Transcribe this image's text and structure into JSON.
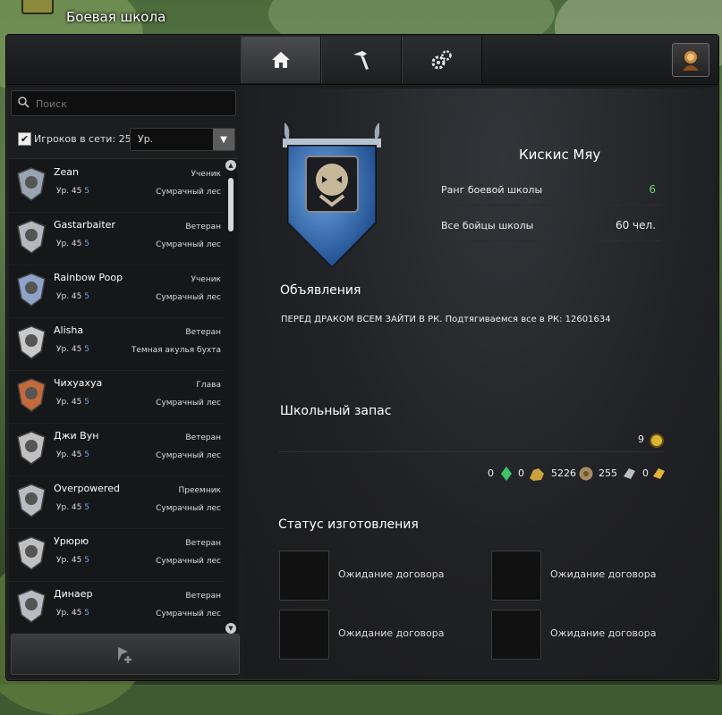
{
  "window": {
    "title": "Боевая школа"
  },
  "tabs": [
    {
      "icon": "home-icon",
      "active": true
    },
    {
      "icon": "hammer-icon",
      "active": false
    },
    {
      "icon": "gears-icon",
      "active": false
    }
  ],
  "left": {
    "search_placeholder": "Поиск",
    "online_label": "Игроков в сети: 25",
    "online_checked": true,
    "sort_value": "Ур."
  },
  "members": [
    {
      "name": "Zean",
      "rank": "Ученик",
      "level_prefix": "Ур. 45",
      "level_sub": "5",
      "location": "Сумрачный лес"
    },
    {
      "name": "Gastarbaiter",
      "rank": "Ветеран",
      "level_prefix": "Ур. 45",
      "level_sub": "5",
      "location": "Сумрачный лес"
    },
    {
      "name": "Rainbow Poop",
      "rank": "Ученик",
      "level_prefix": "Ур. 45",
      "level_sub": "5",
      "location": "Сумрачный лес"
    },
    {
      "name": "Alisha",
      "rank": "Ветеран",
      "level_prefix": "Ур. 45",
      "level_sub": "5",
      "location": "Темная акулья бухта"
    },
    {
      "name": "Чихуахуа",
      "rank": "Глава",
      "level_prefix": "Ур. 45",
      "level_sub": "5",
      "location": "Сумрачный лес"
    },
    {
      "name": "Джи Вун",
      "rank": "Ветеран",
      "level_prefix": "Ур. 45",
      "level_sub": "5",
      "location": "Сумрачный лес"
    },
    {
      "name": "Overpowered",
      "rank": "Преемник",
      "level_prefix": "Ур. 45",
      "level_sub": "5",
      "location": "Сумрачный лес"
    },
    {
      "name": "Урюрю",
      "rank": "Ветеран",
      "level_prefix": "Ур. 45",
      "level_sub": "5",
      "location": "Сумрачный лес"
    },
    {
      "name": "Динаер",
      "rank": "Ветеран",
      "level_prefix": "Ур. 45",
      "level_sub": "5",
      "location": "Сумрачный лес"
    }
  ],
  "school": {
    "name": "Кискис Мяу",
    "rank_label": "Ранг боевой школы",
    "rank_value": "6",
    "fighters_label": "Все бойцы школы",
    "fighters_value": "60 чел."
  },
  "announcements": {
    "title": "Объявления",
    "text": "ПЕРЕД ДРАКОМ ВСЕМ ЗАЙТИ В РК. Подтягиваемся все в РК: 12601634"
  },
  "treasury": {
    "title": "Школьный запас",
    "gold": "9",
    "currencies": [
      {
        "icon": "green-crystal-icon",
        "value": "0"
      },
      {
        "icon": "gold-ore-icon",
        "value": "0"
      },
      {
        "icon": "wood-icon",
        "value": "5226"
      },
      {
        "icon": "silver-ingot-icon",
        "value": "255"
      },
      {
        "icon": "gold-ingot-icon",
        "value": "0"
      }
    ]
  },
  "crafting": {
    "title": "Статус изготовления",
    "slots": [
      {
        "status": "Ожидание договора"
      },
      {
        "status": "Ожидание договора"
      },
      {
        "status": "Ожидание договора"
      },
      {
        "status": "Ожидание договора"
      }
    ]
  },
  "colors": {
    "accent_green": "#6fd36f",
    "level_blue": "#6ea0e8",
    "emblem_blue": "#2f6fc2"
  }
}
